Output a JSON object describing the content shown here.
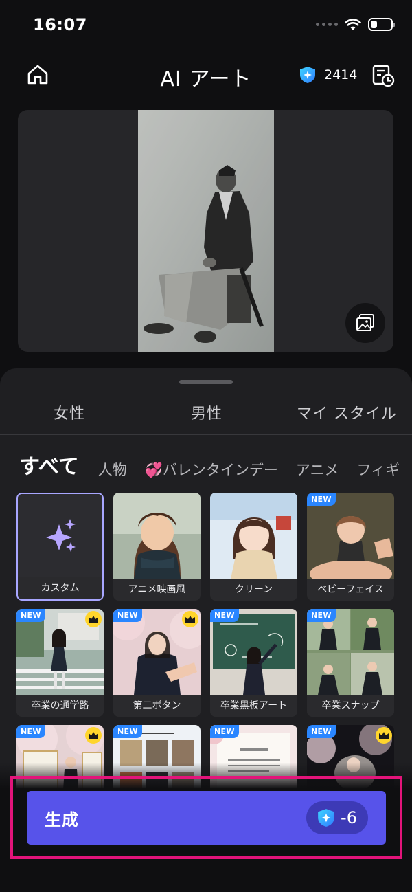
{
  "status_bar": {
    "time": "16:07"
  },
  "header": {
    "title": "AI アート",
    "credits": "2414"
  },
  "gender_tabs": [
    "女性",
    "男性",
    "マイ スタイル"
  ],
  "category_tabs": [
    "すべて",
    "人物",
    "💞バレンタインデー",
    "アニメ",
    "フィギ"
  ],
  "styles": [
    {
      "label": "カスタム"
    },
    {
      "label": "アニメ映画風"
    },
    {
      "label": "クリーン"
    },
    {
      "label": "ベビーフェイス",
      "badge": "NEW"
    },
    {
      "label": "卒業の通学路",
      "badge": "NEW"
    },
    {
      "label": "第二ボタン",
      "badge": "NEW"
    },
    {
      "label": "卒業黒板アート",
      "badge": "NEW"
    },
    {
      "label": "卒業スナップ",
      "badge": "NEW"
    },
    {
      "badge": "NEW"
    },
    {
      "badge": "NEW"
    },
    {
      "badge": "NEW"
    },
    {
      "badge": "NEW"
    }
  ],
  "generate": {
    "label": "生成",
    "cost": "-6"
  },
  "colors": {
    "accent": "#5753ea",
    "highlight_frame": "#e3147a",
    "selected_border": "#a8a6ff",
    "new_badge": "#2a86ff",
    "crown": "#ffd52c"
  }
}
